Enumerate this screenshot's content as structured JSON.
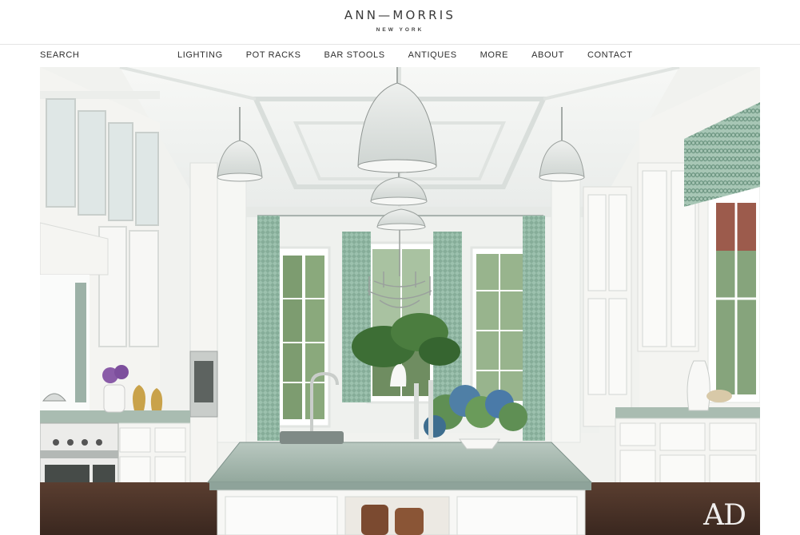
{
  "brand": {
    "name": "ANN—MORRIS",
    "location": "NEW YORK"
  },
  "nav": {
    "search_label": "SEARCH",
    "items": [
      {
        "label": "LIGHTING"
      },
      {
        "label": "POT RACKS"
      },
      {
        "label": "BAR STOOLS"
      },
      {
        "label": "ANTIQUES"
      },
      {
        "label": "MORE"
      },
      {
        "label": "ABOUT"
      },
      {
        "label": "CONTACT"
      }
    ]
  },
  "hero": {
    "watermark": "AD",
    "colors": {
      "cabinet": "#f4f4f1",
      "countertop": "#9fb3a8",
      "curtain": "#8fb7a4",
      "floor": "#4a3329"
    }
  }
}
